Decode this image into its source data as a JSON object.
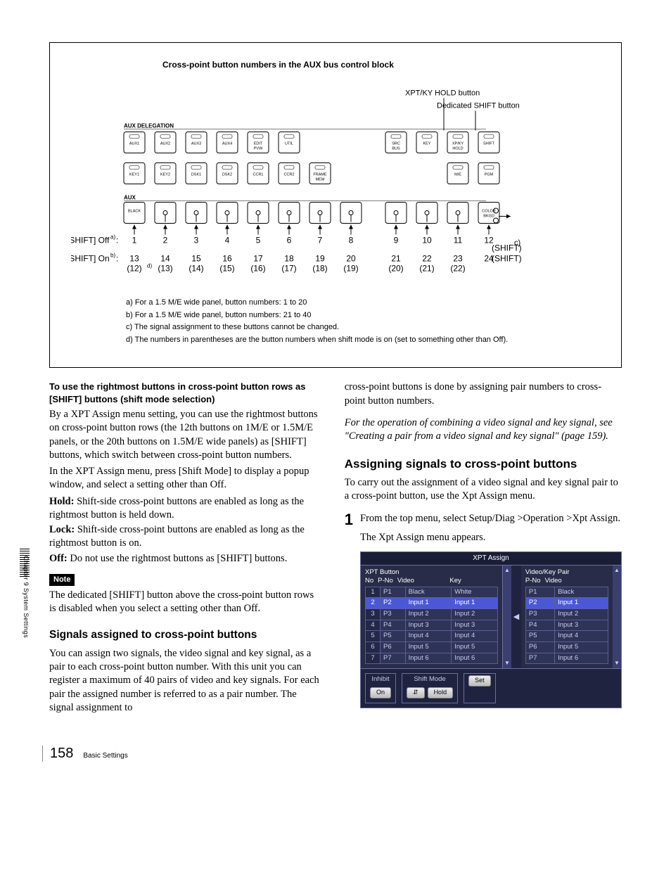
{
  "sideTab": "Chapter 9  System Settings",
  "diagram": {
    "title": "Cross-point button numbers in the AUX bus control block",
    "labels": {
      "auxDelegation": "AUX DELEGATION",
      "aux": "AUX",
      "xptHold": "XPT/KY HOLD button",
      "shiftBtn": "Dedicated SHIFT button"
    },
    "row1": [
      "AUX1",
      "AUX2",
      "AUX3",
      "AUX4",
      "EDIT PVW",
      "UTIL",
      "",
      "",
      "SRC BUS",
      "KEY",
      "XP/KY HOLD",
      "SHIFT"
    ],
    "row2": [
      "KEY1",
      "KEY2",
      "DSK1",
      "DSK2",
      "CCR1",
      "CCR2",
      "FRAME MEM",
      "",
      "",
      "",
      "M/E",
      "PGM"
    ],
    "row3": [
      "BLACK",
      "",
      "",
      "",
      "",
      "",
      "",
      "",
      "",
      "",
      "",
      "COLOR BKGD"
    ],
    "shiftOff": {
      "label": "[SHIFT] Off",
      "sup": "a)",
      "values": [
        "1",
        "2",
        "3",
        "4",
        "5",
        "6",
        "7",
        "8",
        "9",
        "10",
        "11",
        "12"
      ],
      "right": "(SHIFT)"
    },
    "shiftOn": {
      "label": "[SHIFT] On",
      "sup": "b)",
      "values": [
        "13",
        "14",
        "15",
        "16",
        "17",
        "18",
        "19",
        "20",
        "21",
        "22",
        "23",
        "24"
      ],
      "right": "(SHIFT)",
      "paren": [
        "(12)",
        "(13)",
        "(14)",
        "(15)",
        "(16)",
        "(17)",
        "(18)",
        "(19)",
        "(20)",
        "(21)",
        "(22)",
        ""
      ],
      "psup": "d)"
    },
    "cLabel": "c)",
    "notes": [
      "a) For a 1.5 M/E wide panel, button numbers: 1 to 20",
      "b) For a 1.5 M/E wide panel, button numbers: 21 to 40",
      "c) The signal assignment to these buttons cannot be changed.",
      "d) The numbers in parentheses are the button numbers when shift mode is on (set to something other than Off)."
    ]
  },
  "leftCol": {
    "head1": "To use the rightmost buttons in cross-point button rows as [SHIFT] buttons (shift mode selection)",
    "p1": "By a XPT Assign menu setting, you can use the rightmost buttons on cross-point button rows (the 12th buttons on 1M/E or 1.5M/E panels, or the 20th buttons on 1.5M/E wide panels) as [SHIFT] buttons, which switch between cross-point button numbers.",
    "p2": "In the XPT Assign menu, press [Shift Mode] to display a popup window, and select a setting other than Off.",
    "hold_b": "Hold:",
    "hold_t": " Shift-side cross-point buttons are enabled as long as the rightmost button is held down.",
    "lock_b": "Lock:",
    "lock_t": " Shift-side cross-point buttons are enabled as long as the rightmost button is on.",
    "off_b": "Off:",
    "off_t": " Do not use the rightmost buttons as [SHIFT] buttons.",
    "note": "Note",
    "noteText": "The dedicated [SHIFT] button above the cross-point button rows is disabled when you select a setting other than Off.",
    "head2": "Signals assigned to cross-point buttons",
    "p3": "You can assign two signals, the video signal and key signal, as a pair to each cross-point button number. With this unit you can register a maximum of 40 pairs of video and key signals. For each pair the assigned number is referred to as a pair number. The signal assignment to"
  },
  "rightCol": {
    "p1": "cross-point buttons is done by assigning pair numbers to cross-point button numbers.",
    "ital": "For the operation of combining a video signal and key signal, see \"Creating a pair from a video signal and key signal\" (page 159).",
    "head": "Assigning signals to cross-point buttons",
    "p2": "To carry out the assignment of a video signal and key signal pair to a cross-point button, use the Xpt Assign menu.",
    "step1": "From the top menu, select Setup/Diag >Operation >Xpt Assign.",
    "step1b": "The Xpt Assign menu appears."
  },
  "menu": {
    "title": "XPT Assign",
    "leftHead": {
      "a": "XPT Button",
      "b": "No",
      "c": "P-No",
      "d": "Video",
      "e": "Key"
    },
    "rightHead": {
      "a": "Video/Key Pair",
      "b": "P-No",
      "c": "Video"
    },
    "rowsLeft": [
      {
        "n": "1",
        "p": "P1",
        "v": "Black",
        "k": "White"
      },
      {
        "n": "2",
        "p": "P2",
        "v": "Input 1",
        "k": "Input 1"
      },
      {
        "n": "3",
        "p": "P3",
        "v": "Input 2",
        "k": "Input 2"
      },
      {
        "n": "4",
        "p": "P4",
        "v": "Input 3",
        "k": "Input 3"
      },
      {
        "n": "5",
        "p": "P5",
        "v": "Input 4",
        "k": "Input 4"
      },
      {
        "n": "6",
        "p": "P6",
        "v": "Input 5",
        "k": "Input 5"
      },
      {
        "n": "7",
        "p": "P7",
        "v": "Input 6",
        "k": "Input 6"
      }
    ],
    "rowsRight": [
      {
        "p": "P1",
        "v": "Black"
      },
      {
        "p": "P2",
        "v": "Input 1"
      },
      {
        "p": "P3",
        "v": "Input 2"
      },
      {
        "p": "P4",
        "v": "Input 3"
      },
      {
        "p": "P5",
        "v": "Input 4"
      },
      {
        "p": "P6",
        "v": "Input 5"
      },
      {
        "p": "P7",
        "v": "Input 6"
      }
    ],
    "footer": {
      "inhibit": "Inhibit",
      "on": "On",
      "shiftMode": "Shift Mode",
      "hold": "Hold",
      "set": "Set",
      "link": "⇵"
    }
  },
  "footer": {
    "page": "158",
    "label": "Basic Settings"
  }
}
